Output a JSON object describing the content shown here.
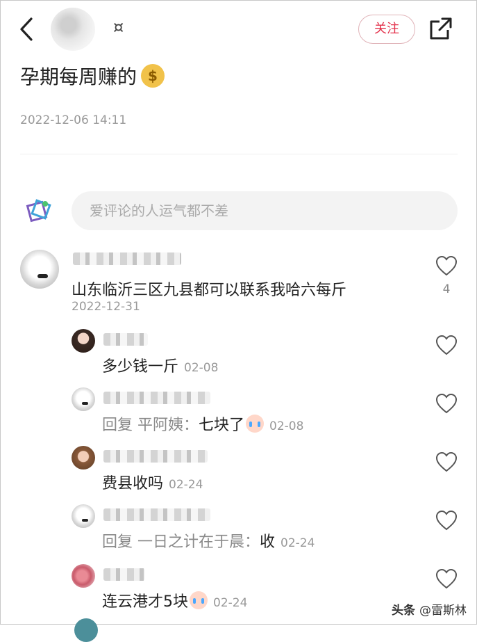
{
  "header": {
    "user_name": "¤",
    "follow_label": "关注",
    "icons": [
      "chevron-left-icon",
      "share-icon"
    ]
  },
  "post": {
    "title": "孕期每周赚的",
    "title_icon": "money-bag-icon",
    "date": "2022-12-06 14:11"
  },
  "comment_input": {
    "placeholder": "爱评论的人运气都不差"
  },
  "comments": {
    "main": {
      "text": "山东临沂三区九县都可以联系我哈六每斤",
      "date": "2022-12-31",
      "likes": "4"
    },
    "replies": [
      {
        "text": "多少钱一斤",
        "quoted": "",
        "time": "02-08",
        "emoji": false
      },
      {
        "text": "七块了",
        "quoted": "回复 平阿姨：",
        "time": "02-08",
        "emoji": true
      },
      {
        "text": "费县收吗",
        "quoted": "",
        "time": "02-24",
        "emoji": false
      },
      {
        "text": "收",
        "quoted": "回复 一日之计在于晨：",
        "time": "02-24",
        "emoji": false
      },
      {
        "text": "连云港才5块",
        "quoted": "",
        "time": "02-24",
        "emoji": true
      }
    ]
  },
  "watermark": {
    "head": "头条",
    "handle": "@雷斯林"
  },
  "colors": {
    "accent": "#e3304a",
    "muted": "#999999"
  }
}
